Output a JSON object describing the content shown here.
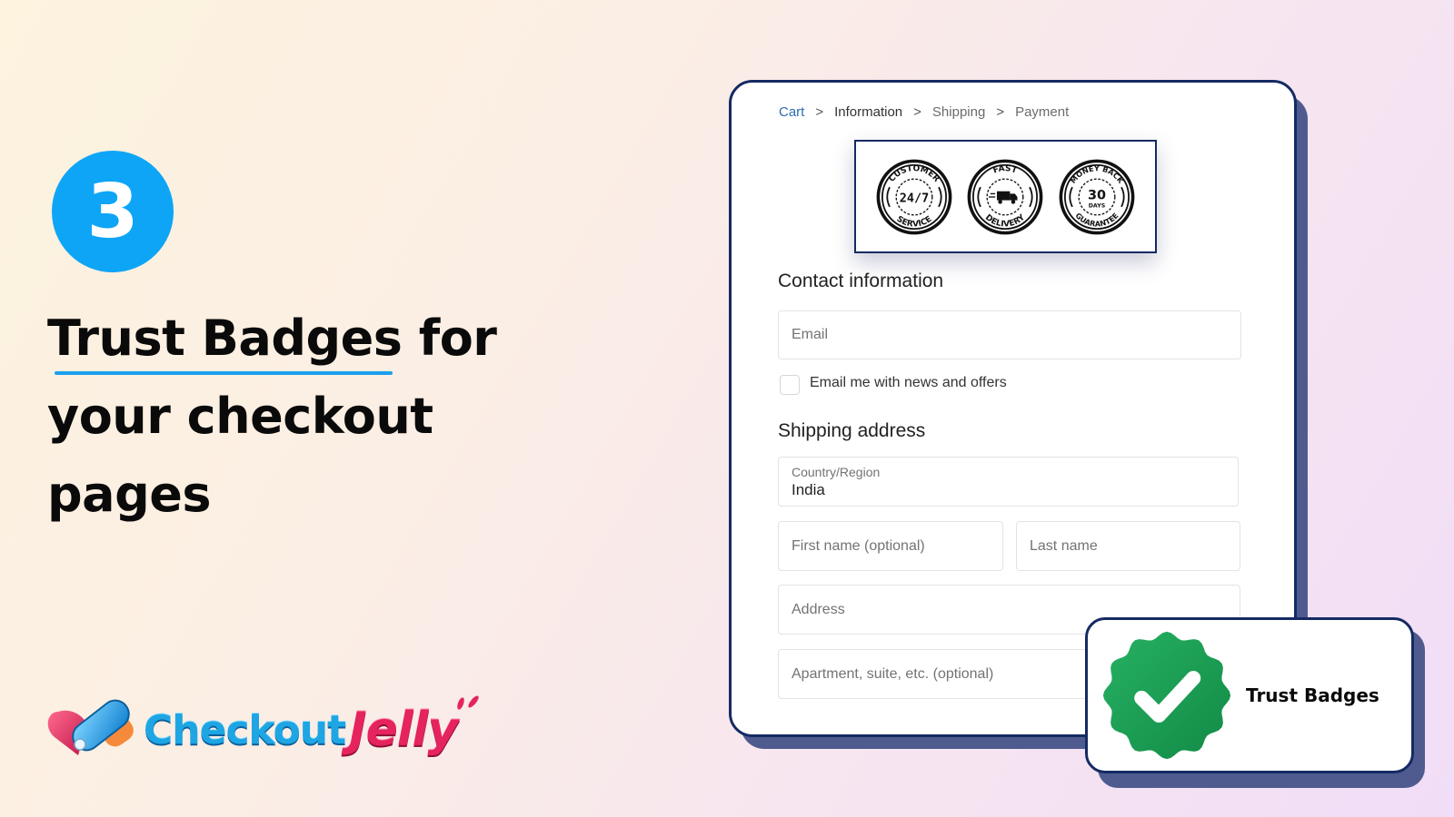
{
  "promo": {
    "step_number": "3",
    "headline_lines": [
      "Trust Badges for",
      "your checkout",
      "pages"
    ],
    "accent_color": "#0ea5f6"
  },
  "logo": {
    "word_1": "Checkout",
    "word_2": "Jelly",
    "colors": {
      "checkout": "#1ea6e4",
      "jelly": "#e5235d"
    }
  },
  "checkout": {
    "breadcrumb": {
      "items": [
        "Cart",
        "Information",
        "Shipping",
        "Payment"
      ],
      "separator": ">",
      "active": "Information"
    },
    "trust_badges": [
      {
        "top_text": "CUSTOMER",
        "center_text": "24/7",
        "bottom_text": "SERVICE",
        "icon": "clock-icon"
      },
      {
        "top_text": "FAST",
        "center_text": "",
        "bottom_text": "DELIVERY",
        "icon": "truck-icon"
      },
      {
        "top_text": "MONEY BACK",
        "center_text": "30",
        "center_sub": "DAYS",
        "bottom_text": "GUARANTEE",
        "icon": "money-icon"
      }
    ],
    "contact": {
      "title": "Contact information",
      "email_placeholder": "Email",
      "newsletter_label": "Email me with news and offers",
      "newsletter_checked": false
    },
    "shipping": {
      "title": "Shipping address",
      "country_label": "Country/Region",
      "country_value": "India",
      "first_name_placeholder": "First name (optional)",
      "last_name_placeholder": "Last name",
      "address_placeholder": "Address",
      "apartment_placeholder": "Apartment, suite, etc. (optional)"
    }
  },
  "callout": {
    "label": "Trust Badges",
    "badge_color": "#1e9e55",
    "frame_color": "#152a63"
  }
}
